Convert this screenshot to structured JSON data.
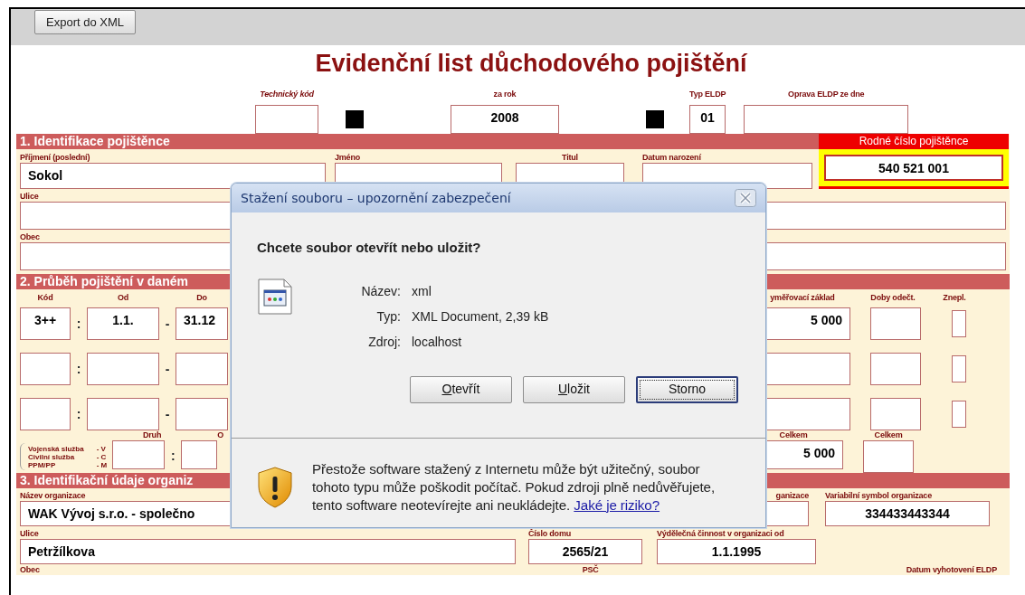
{
  "toolbar": {
    "export_button": "Export do XML"
  },
  "form": {
    "title": "Evidenční list důchodového pojištění",
    "header": {
      "technical_code_label": "Technický kód",
      "year_label": "za rok",
      "year": "2008",
      "type_label": "Typ ELDP",
      "type": "01",
      "correction_label": "Oprava ELDP ze dne"
    },
    "birth_number": {
      "label": "Rodné číslo pojištěnce",
      "value": "540 521 001"
    },
    "section1": {
      "title": "1. Identifikace pojištěnce",
      "surname_label": "Příjmení (poslední)",
      "surname": "Sokol",
      "first_name_label": "Jméno",
      "academic_title_label": "Titul",
      "birth_date_label": "Datum narození",
      "street_label": "Ulice",
      "city_label": "Obec"
    },
    "section2": {
      "title": "2. Průběh pojištění v daném",
      "columns": {
        "code": "Kód",
        "from": "Od",
        "to": "Do",
        "base": "yměřovací základ",
        "deduct": "Doby odečt.",
        "unemployed": "Znepl."
      },
      "rows": [
        {
          "kind": "entry",
          "code": "3++",
          "colon": ":",
          "from": "1.1.",
          "dash": "-",
          "to": "31.12",
          "base": "5 000",
          "checked": false
        },
        {
          "kind": "blank",
          "colon": ":",
          "dash": "-",
          "checked": false
        },
        {
          "kind": "blank",
          "colon": ":",
          "dash": "-",
          "checked": false
        }
      ],
      "legend": [
        {
          "text": "Vojenská služba",
          "code": "- V"
        },
        {
          "text": "Civilní služba",
          "code": "- C"
        },
        {
          "text": "PPM/PP",
          "code": "- M"
        }
      ],
      "kind_label": "Druh",
      "kind_colon": ":",
      "column_o": "O",
      "total_base_label": "Celkem",
      "total_base": "5 000",
      "total_deduct_label": "Celkem"
    },
    "section3": {
      "title": "3. Identifikační údaje organiz",
      "org_name_label": "Název organizace",
      "org_name": "WAK Vývoj s.r.o. - společno",
      "id_label": "ganizace",
      "var_symbol_label": "Variabilní symbol organizace",
      "var_symbol": "334433443344",
      "street_label": "Ulice",
      "street": "Petržílkova",
      "house_label": "Číslo domu",
      "house": "2565/21",
      "since_label": "Výdělečná činnost v organizaci od",
      "since": "1.1.1995",
      "city_label": "Obec",
      "zip_label": "PSČ",
      "created_label": "Datum vyhotovení ELDP"
    }
  },
  "dialog": {
    "title": "Stažení souboru – upozornění zabezpečení",
    "question": "Chcete soubor otevřít nebo uložit?",
    "details": [
      {
        "label": "Název:",
        "value": "xml"
      },
      {
        "label": "Typ:",
        "value": "XML Document, 2,39 kB"
      },
      {
        "label": "Zdroj:",
        "value": "localhost"
      }
    ],
    "buttons": [
      {
        "label": "Otevřít",
        "underline_first": true,
        "focused": false
      },
      {
        "label": "Uložit",
        "underline_first": true,
        "focused": false
      },
      {
        "label": "Storno",
        "underline_first": false,
        "focused": true
      }
    ],
    "warning": {
      "text": "Přestože software stažený z Internetu může být užitečný, soubor tohoto typu může poškodit počítač. Pokud zdroji plně nedůvěřujete, tento software neotevírejte ani neukládejte.",
      "link": "Jaké je riziko?"
    }
  }
}
